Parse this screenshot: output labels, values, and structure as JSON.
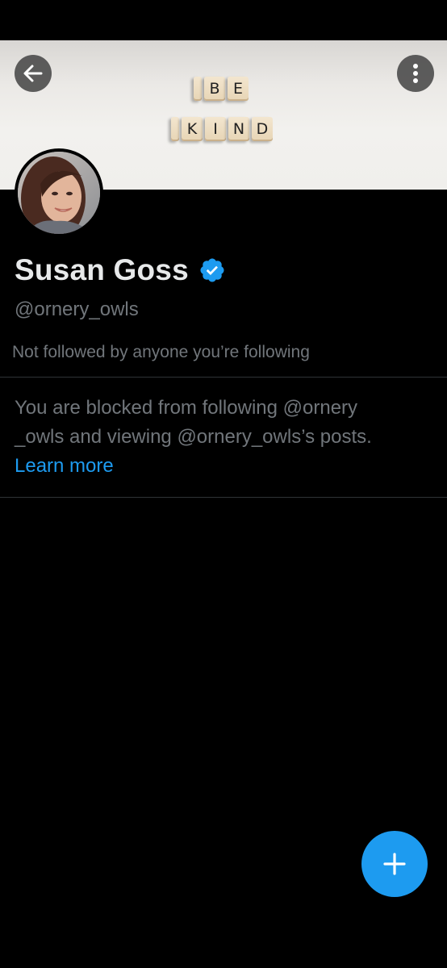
{
  "profile": {
    "display_name": "Susan Goss",
    "handle": "@ornery_owls",
    "followers_note": "Not followed by anyone you’re following",
    "verified_icon": "verified-badge-icon"
  },
  "banner": {
    "tiles_row1": [
      "B",
      "E"
    ],
    "tiles_row2": [
      "K",
      "I",
      "N",
      "D"
    ]
  },
  "blocked_notice": {
    "line1": "You are blocked from following @ornery",
    "line2": "_owls and viewing @ornery_owls’s posts.",
    "learn_more": "Learn more"
  },
  "colors": {
    "background": "#000000",
    "accent": "#1d9bf0",
    "secondary_text": "#71767b",
    "primary_text": "#e7e9ea",
    "divider": "#2f3336"
  },
  "icons": {
    "back": "arrow-left-icon",
    "more": "more-vertical-icon",
    "compose": "plus-icon"
  }
}
